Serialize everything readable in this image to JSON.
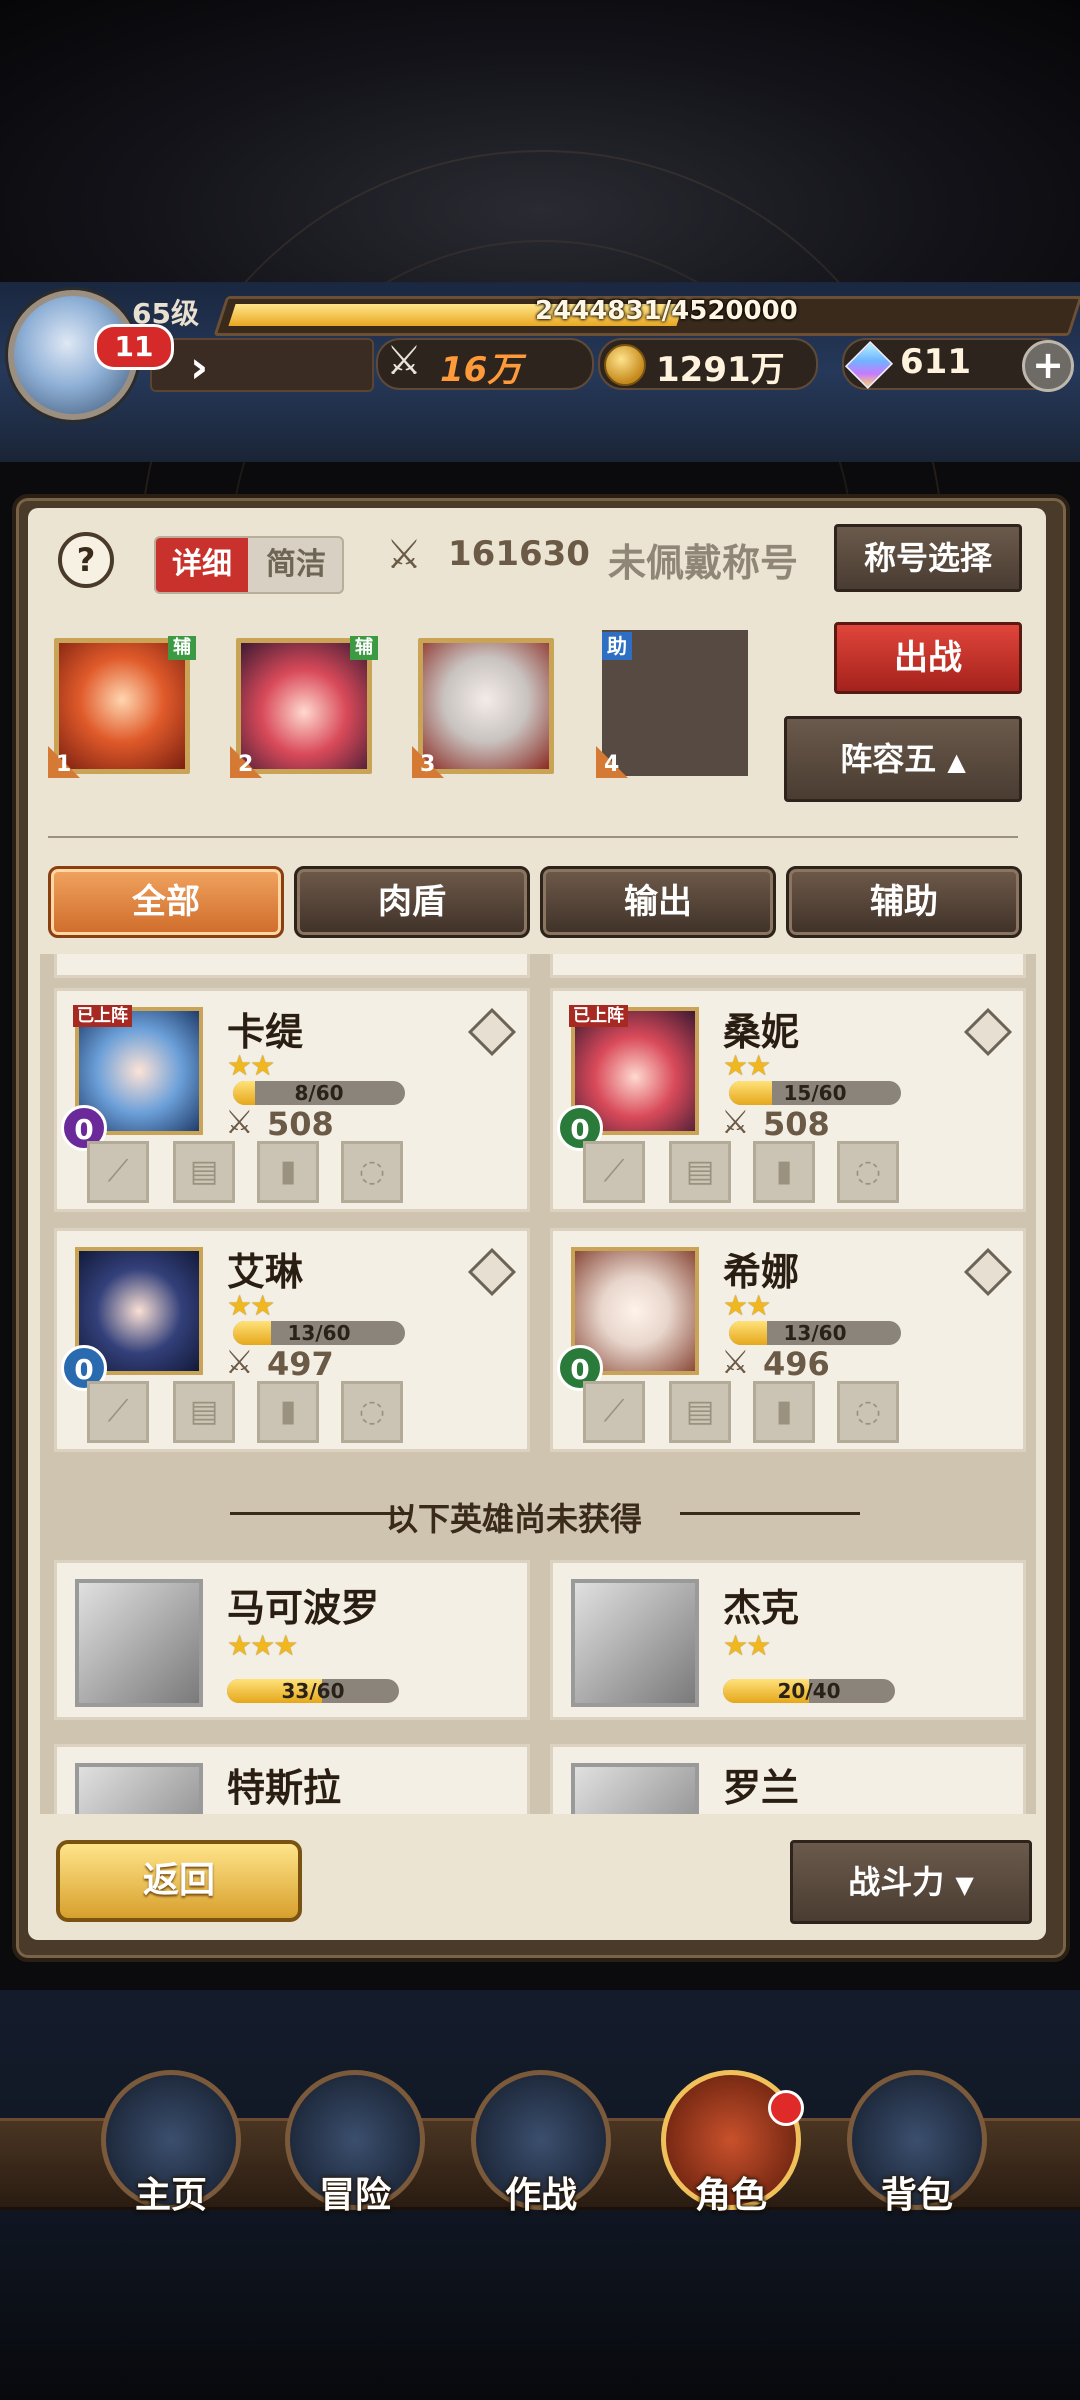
{
  "header": {
    "level": "65级",
    "xp_text": "2444831/4520000",
    "xp_fraction": 0.54,
    "notification_count": "11",
    "power": "16万",
    "gold": "1291万",
    "gems": "611"
  },
  "panel": {
    "toggle": {
      "detail": "详细",
      "simple": "简洁"
    },
    "team_power": "161630",
    "title_status": "未佩戴称号",
    "title_select": "称号选择",
    "deploy": "出战",
    "lineup": "阵容五",
    "slots": [
      {
        "num": "1",
        "tag": "辅"
      },
      {
        "num": "2",
        "tag": "辅"
      },
      {
        "num": "3",
        "tag": ""
      },
      {
        "num": "4",
        "tag": "助"
      }
    ],
    "filters": [
      "全部",
      "肉盾",
      "输出",
      "辅助"
    ]
  },
  "heroes": [
    {
      "name": "卡缇",
      "stars": "★★",
      "progress": "8/60",
      "fraction": 0.13,
      "power": "508",
      "deployed": "已上阵",
      "level": "0"
    },
    {
      "name": "桑妮",
      "stars": "★★",
      "progress": "15/60",
      "fraction": 0.25,
      "power": "508",
      "deployed": "已上阵",
      "level": "0"
    },
    {
      "name": "艾琳",
      "stars": "★★",
      "progress": "13/60",
      "fraction": 0.22,
      "power": "497",
      "deployed": "",
      "level": "0"
    },
    {
      "name": "希娜",
      "stars": "★★",
      "progress": "13/60",
      "fraction": 0.22,
      "power": "496",
      "deployed": "",
      "level": "0"
    }
  ],
  "locked_note": "以下英雄尚未获得",
  "locked_heroes": [
    {
      "name": "马可波罗",
      "stars": "★★★",
      "progress": "33/60",
      "fraction": 0.55
    },
    {
      "name": "杰克",
      "stars": "★★",
      "progress": "20/40",
      "fraction": 0.5
    },
    {
      "name": "特斯拉"
    },
    {
      "name": "罗兰"
    }
  ],
  "footer": {
    "back": "返回",
    "sort": "战斗力"
  },
  "nav": [
    "主页",
    "冒险",
    "作战",
    "角色",
    "背包"
  ]
}
